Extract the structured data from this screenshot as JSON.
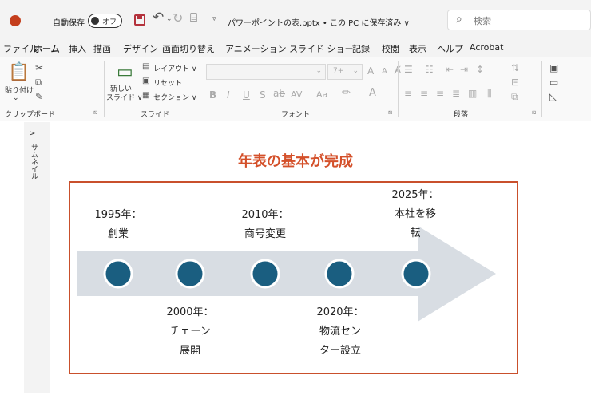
{
  "titlebar": {
    "autosave_label": "自動保存",
    "autosave_state": "オフ",
    "doc_title": "パワーポイントの表.pptx • この PC に保存済み ∨",
    "search_placeholder": "検索"
  },
  "ribbon_tabs": [
    "ファイル",
    "ホーム",
    "挿入",
    "描画",
    "デザイン",
    "画面切り替え",
    "アニメーション",
    "スライド ショー",
    "記録",
    "校閲",
    "表示",
    "ヘルプ",
    "Acrobat"
  ],
  "ribbon": {
    "clipboard": {
      "paste": "貼り付け",
      "group_label": "クリップボード"
    },
    "slides": {
      "new_slide_1": "新しい",
      "new_slide_2": "スライド ∨",
      "layout": "レイアウト ∨",
      "reset": "リセット",
      "section": "セクション ∨",
      "group_label": "スライド"
    },
    "font": {
      "size_value": "7+",
      "grow": "A",
      "shrink": "A",
      "bold": "B",
      "italic": "I",
      "underline": "U",
      "strike": "S",
      "spacing": "AV",
      "case": "Aa",
      "group_label": "フォント"
    },
    "paragraph": {
      "group_label": "段落"
    }
  },
  "thumbnail_pane": {
    "label": "サムネイル",
    "expand": ">"
  },
  "slide": {
    "title": "年表の基本が完成",
    "events": [
      {
        "lines": [
          "1995年：",
          "創業"
        ]
      },
      {
        "lines": [
          "2000年：",
          "チェーン",
          "展開"
        ]
      },
      {
        "lines": [
          "2010年：",
          "商号変更"
        ]
      },
      {
        "lines": [
          "2020年：",
          "物流セン",
          "ター設立"
        ]
      },
      {
        "lines": [
          "2025年：",
          "本社を移",
          "転"
        ]
      }
    ],
    "colors": {
      "title": "#d4502a",
      "frame": "#c9502c",
      "arrow": "#d8dde3",
      "dot": "#1a5e80"
    }
  }
}
